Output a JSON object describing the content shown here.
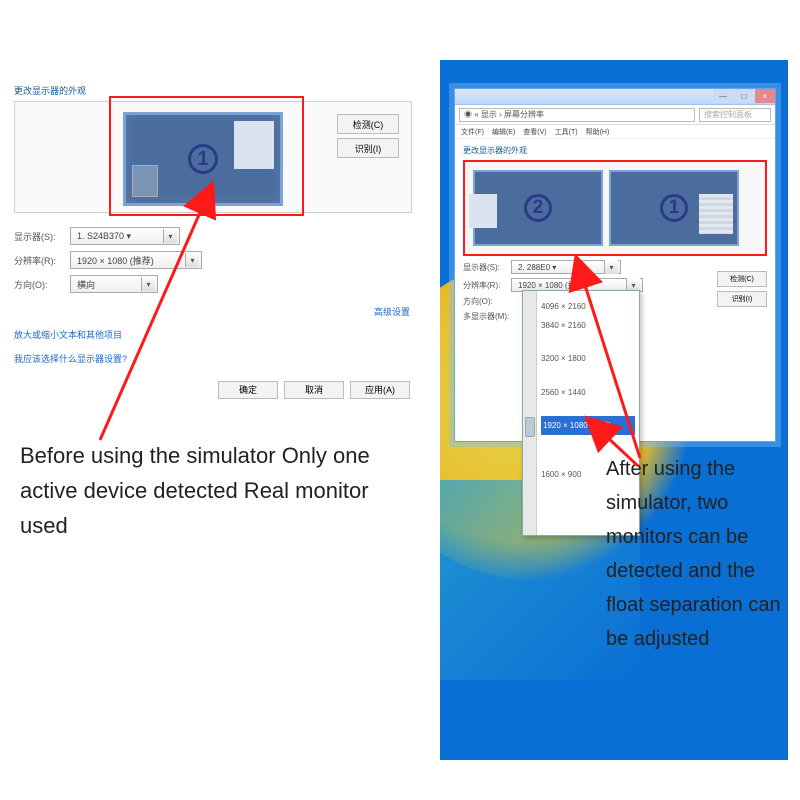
{
  "left": {
    "title": "更改显示器的外观",
    "monitor_num": "1",
    "btn_detect": "检测(C)",
    "btn_identify": "识别(I)",
    "fields": {
      "display_label": "显示器(S):",
      "display_value": "1. S24B370 ▾",
      "res_label": "分辨率(R):",
      "res_value": "1920 × 1080 (推荐)",
      "orient_label": "方向(O):",
      "orient_value": "横向"
    },
    "adv_link": "高级设置",
    "blurb1": "放大或缩小文本和其他项目",
    "blurb2": "我应该选择什么显示器设置?",
    "btn_ok": "确定",
    "btn_cancel": "取消",
    "btn_apply": "应用(A)"
  },
  "right": {
    "addr_path": "◉ « 显示 › 屏幕分辨率",
    "search_placeholder": "搜索控制面板",
    "menu": [
      "文件(F)",
      "编辑(E)",
      "查看(V)",
      "工具(T)",
      "帮助(H)"
    ],
    "title": "更改显示器的外观",
    "monitor2": "2",
    "monitor1": "1",
    "btn_detect": "检测(C)",
    "btn_identify": "识别(I)",
    "fields": {
      "display_label": "显示器(S):",
      "display_value": "2. 288E0 ▾",
      "res_label": "分辨率(R):",
      "res_value": "1920 × 1080 (推荐)",
      "orient_label": "方向(O):",
      "multi_label": "多显示器(M):"
    },
    "resolutions": [
      "4096 × 2160",
      "3840 × 2160",
      "3200 × 1800",
      "2560 × 1440",
      "1920 × 1080 (推荐)",
      "",
      "1600 × 900"
    ],
    "selected_res": "1920 × 1080 (推荐)"
  },
  "caption_left": "Before using the simulator Only one active device detected Real monitor used",
  "caption_right": "After using the simulator, two monitors can be detected and the float separation can be adjusted"
}
